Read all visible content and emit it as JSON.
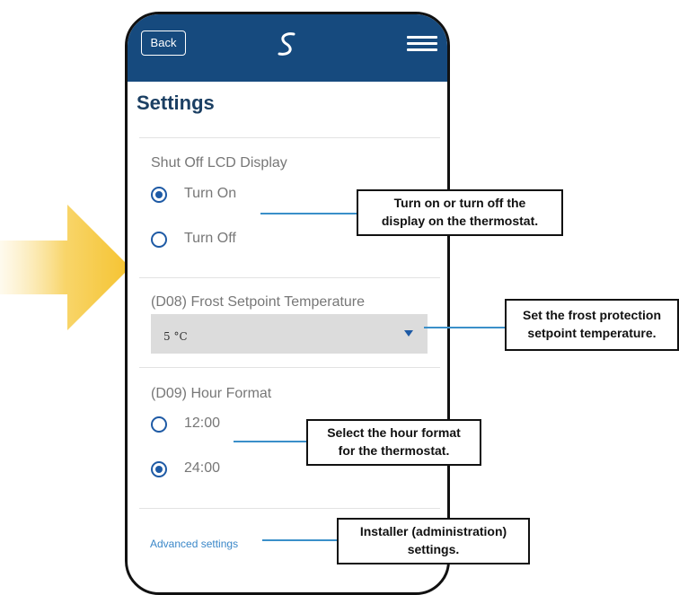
{
  "appbar": {
    "back_label": "Back"
  },
  "page": {
    "title": "Settings"
  },
  "lcd": {
    "label": "Shut Off LCD Display",
    "options": [
      {
        "label": "Turn On",
        "checked": true
      },
      {
        "label": "Turn Off",
        "checked": false
      }
    ]
  },
  "frost": {
    "label": "(D08) Frost Setpoint Temperature",
    "value": "5 °C"
  },
  "hour": {
    "label": "(D09) Hour Format",
    "options": [
      {
        "label": "12:00",
        "checked": false
      },
      {
        "label": "24:00",
        "checked": true
      }
    ]
  },
  "advanced_link": "Advanced settings",
  "callouts": {
    "lcd": [
      "Turn on or turn off the",
      "display on the thermostat."
    ],
    "frost": [
      "Set the frost protection",
      "setpoint temperature."
    ],
    "hour": [
      "Select the hour format",
      "for the thermostat."
    ],
    "installer": [
      "Installer (administration)",
      "settings."
    ]
  },
  "colors": {
    "appbar": "#164a7e",
    "accent": "#1e5aa5",
    "link": "#3a87c8",
    "arrow": "#f5c842"
  }
}
